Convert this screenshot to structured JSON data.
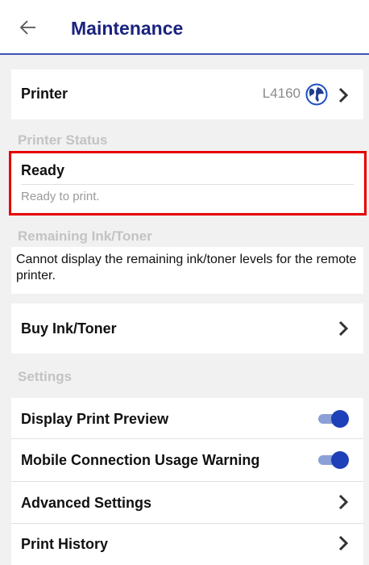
{
  "header": {
    "title": "Maintenance"
  },
  "printer": {
    "label": "Printer",
    "model": "L4160",
    "status_icon": "printer-online-globe-icon"
  },
  "printer_status": {
    "section_label": "Printer Status",
    "status": "Ready",
    "detail": "Ready to print."
  },
  "ink": {
    "section_label": "Remaining Ink/Toner",
    "message": "Cannot display the remaining ink/toner levels for the remote printer."
  },
  "buy": {
    "label": "Buy Ink/Toner"
  },
  "settings": {
    "section_label": "Settings",
    "items": [
      {
        "label": "Display Print Preview",
        "type": "toggle",
        "on": true
      },
      {
        "label": "Mobile Connection Usage Warning",
        "type": "toggle",
        "on": true
      },
      {
        "label": "Advanced Settings",
        "type": "link"
      },
      {
        "label": "Print History",
        "type": "link"
      }
    ]
  },
  "colors": {
    "accent": "#1a237e",
    "toggle_on": "#1e40b8",
    "highlight": "#e60000"
  }
}
